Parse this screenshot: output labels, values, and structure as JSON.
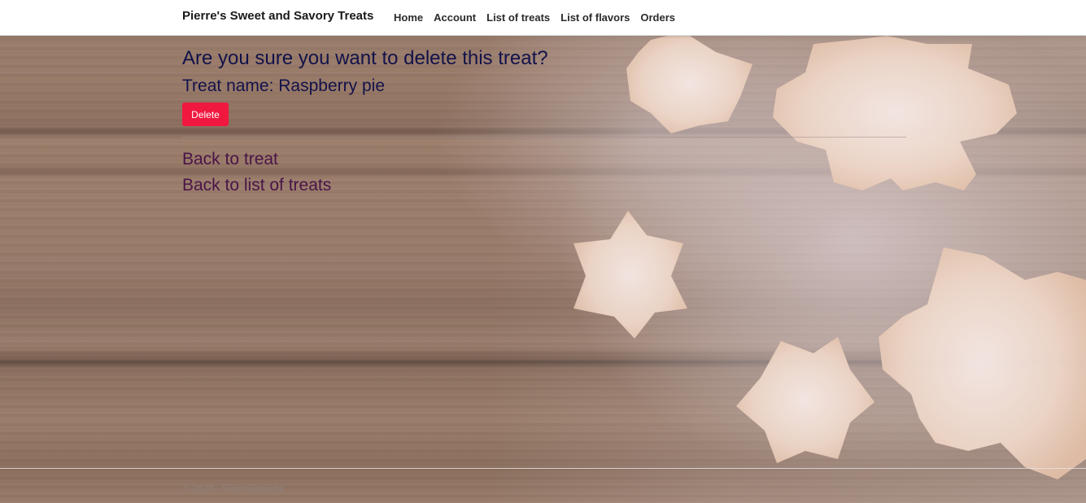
{
  "navbar": {
    "brand": "Pierre's Sweet and Savory Treats",
    "links": [
      {
        "label": "Home"
      },
      {
        "label": "Account"
      },
      {
        "label": "List of treats"
      },
      {
        "label": "List of flavors"
      },
      {
        "label": "Orders"
      }
    ]
  },
  "main": {
    "question": "Are you sure you want to delete this treat?",
    "treat_line": "Treat name: Raspberry pie",
    "delete_label": "Delete",
    "back_to_treat": "Back to treat",
    "back_to_list": "Back to list of treats"
  },
  "footer": {
    "text": "© 2020 - PierreSweets"
  },
  "colors": {
    "delete_button": "#f0183f",
    "heading": "#12124a",
    "link": "#4a1448"
  },
  "background": {
    "description_icon": "wood-and-cookies-background"
  }
}
